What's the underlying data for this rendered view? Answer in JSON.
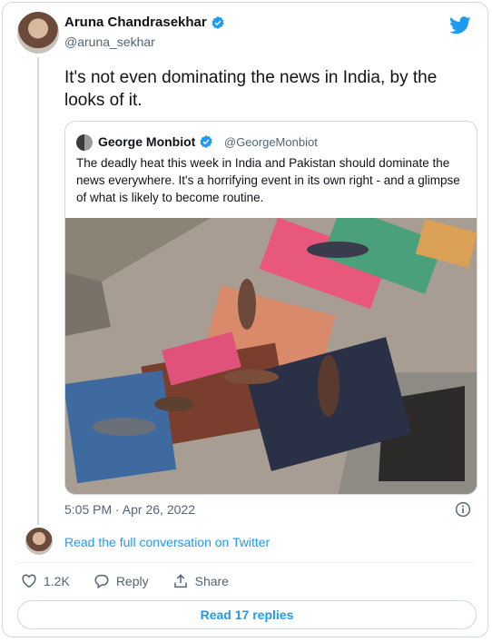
{
  "author": {
    "name": "Aruna Chandrasekhar",
    "handle": "@aruna_sekhar",
    "icon": "verified-badge-icon"
  },
  "tweet": {
    "text": "It's not even dominating the news in India, by the looks of it."
  },
  "quoted": {
    "name": "George Monbiot",
    "handle": "@GeorgeMonbiot",
    "text": "The deadly heat this week in India and Pakistan should dominate the news everywhere. It's a horrifying event in its own right - and a glimpse of what is likely to become routine."
  },
  "meta": {
    "timestamp": "5:05 PM · Apr 26, 2022"
  },
  "conversation": {
    "link_label": "Read the full conversation on Twitter"
  },
  "actions": {
    "like_count": "1.2K",
    "reply_label": "Reply",
    "share_label": "Share"
  },
  "footer": {
    "read_replies_label": "Read 17 replies"
  },
  "colors": {
    "accent": "#1d9bf0",
    "secondary_text": "#536471",
    "border": "#cfd9de"
  }
}
